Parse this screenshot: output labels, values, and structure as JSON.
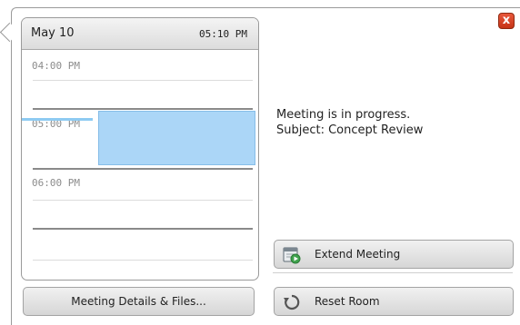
{
  "calendar": {
    "date": "May 10",
    "current_time": "05:10 PM",
    "slots": [
      {
        "label": "04:00 PM"
      },
      {
        "label": "05:00 PM"
      },
      {
        "label": "06:00 PM"
      }
    ]
  },
  "status": {
    "line1": "Meeting is in progress.",
    "line2": "Subject: Concept Review"
  },
  "buttons": {
    "close": "x",
    "details": "Meeting Details & Files...",
    "extend": "Extend Meeting",
    "reset": "Reset Room"
  },
  "icons": {
    "close": "close-icon",
    "extend": "calendar-play-icon",
    "reset": "reset-icon"
  },
  "colors": {
    "meeting_block": "#abd6f7",
    "close_button": "#d9462a",
    "now_marker": "#8ecbf2"
  }
}
